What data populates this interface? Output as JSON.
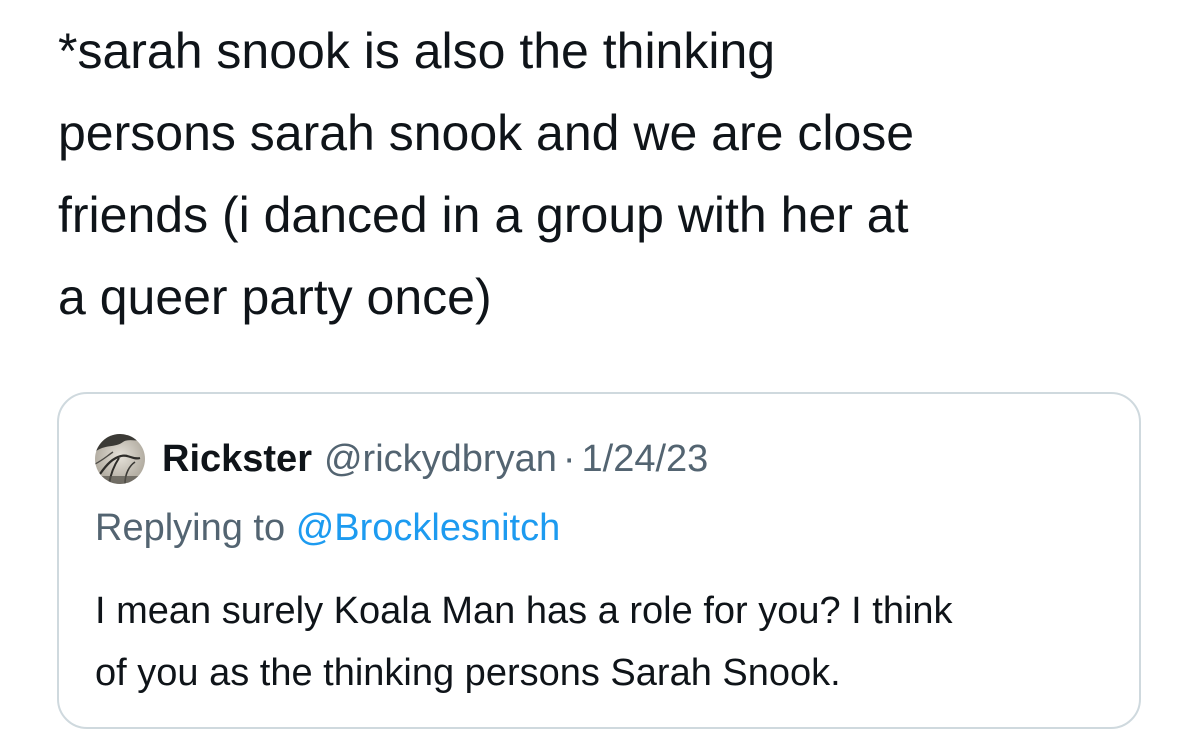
{
  "tweet": {
    "text_lines": [
      "*sarah snook is also the thinking",
      "persons sarah snook and we are close",
      "friends (i danced in a group with her at",
      "a queer party once)"
    ]
  },
  "quote": {
    "avatar_icon": "profile-photo-icon",
    "display_name": "Rickster",
    "handle": "@rickydbryan",
    "separator": "·",
    "date": "1/24/23",
    "replying_prefix": "Replying to",
    "replying_handle": "@Brocklesnitch",
    "body_lines": [
      "I mean surely Koala Man has a role for you? I think",
      "of you as the thinking persons Sarah Snook."
    ]
  },
  "colors": {
    "text": "#0f1419",
    "secondary": "#536471",
    "link": "#1d9bf0",
    "border": "#cfd9de"
  }
}
